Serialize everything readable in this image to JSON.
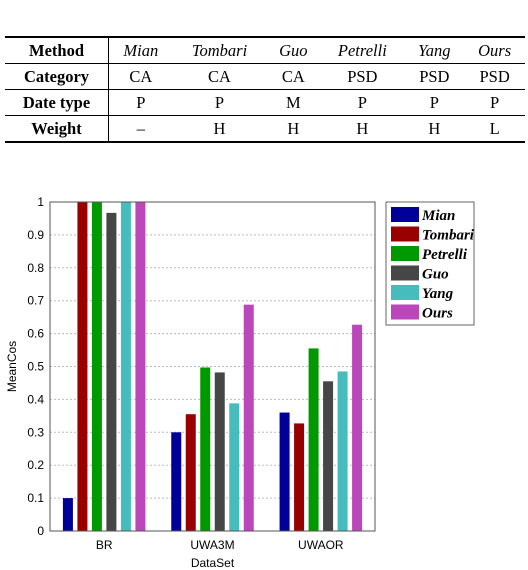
{
  "table": {
    "header_label": "Method",
    "methods": [
      "Mian",
      "Tombari",
      "Guo",
      "Petrelli",
      "Yang",
      "Ours"
    ],
    "rows": [
      {
        "label": "Category",
        "values": [
          "CA",
          "CA",
          "CA",
          "PSD",
          "PSD",
          "PSD"
        ]
      },
      {
        "label": "Date type",
        "values": [
          "P",
          "P",
          "M",
          "P",
          "P",
          "P"
        ]
      },
      {
        "label": "Weight",
        "values": [
          "–",
          "H",
          "H",
          "H",
          "H",
          "L"
        ]
      }
    ]
  },
  "chart_data": {
    "type": "bar",
    "title": "",
    "xlabel": "DataSet",
    "ylabel": "MeanCos",
    "ylim": [
      0,
      1
    ],
    "yticks": [
      "0",
      "0.1",
      "0.2",
      "0.3",
      "0.4",
      "0.5",
      "0.6",
      "0.7",
      "0.8",
      "0.9",
      "1"
    ],
    "grid": true,
    "legend_position": "outside-right-top",
    "categories": [
      "BR",
      "UWA3M",
      "UWAOR"
    ],
    "series": [
      {
        "name": "Mian",
        "color": "#000099",
        "values": [
          0.1,
          0.3,
          0.36
        ]
      },
      {
        "name": "Tombari",
        "color": "#990000",
        "values": [
          1.0,
          0.355,
          0.327
        ]
      },
      {
        "name": "Petrelli",
        "color": "#009900",
        "values": [
          1.0,
          0.497,
          0.555
        ]
      },
      {
        "name": "Guo",
        "color": "#464646",
        "values": [
          0.967,
          0.482,
          0.455
        ]
      },
      {
        "name": "Yang",
        "color": "#47bcbc",
        "values": [
          1.0,
          0.388,
          0.485
        ]
      },
      {
        "name": "Ours",
        "color": "#bb47bb",
        "values": [
          1.0,
          0.688,
          0.627
        ]
      }
    ]
  }
}
